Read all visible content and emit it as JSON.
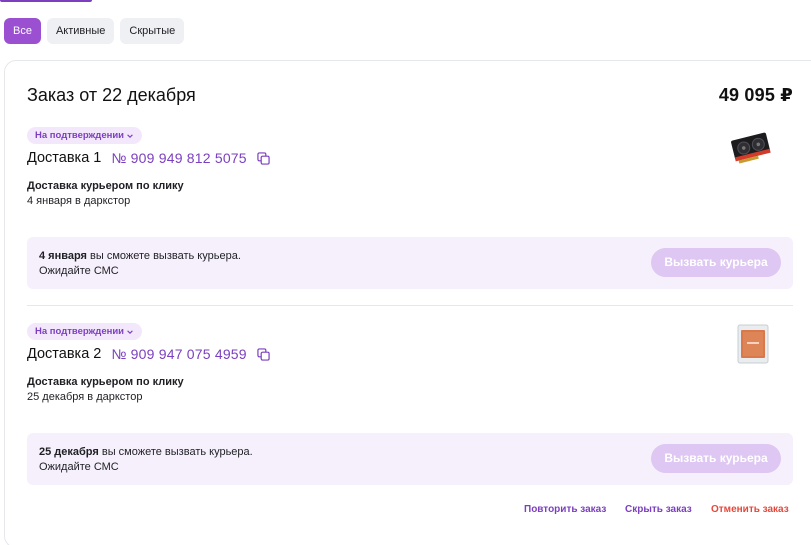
{
  "filters": {
    "all": "Все",
    "active": "Активные",
    "hidden": "Скрытые"
  },
  "order": {
    "title": "Заказ от 22 декабря",
    "total": "49 095 ₽",
    "deliveries": [
      {
        "status": "На подтверждении",
        "name": "Доставка 1",
        "number": "№ 909 949 812 5075",
        "method": "Доставка курьером по клику",
        "date": "4 января в даркстор",
        "courier_date": "4 января",
        "courier_text": " вы сможете вызвать курьера.",
        "courier_wait": "Ожидайте СМС",
        "courier_button": "Вызвать курьера",
        "thumb_icon": "graphics-card-icon"
      },
      {
        "status": "На подтверждении",
        "name": "Доставка 2",
        "number": "№ 909 947 075 4959",
        "method": "Доставка курьером по клику",
        "date": "25 декабря в даркстор",
        "courier_date": "25 декабря",
        "courier_text": " вы сможете вызвать курьера.",
        "courier_wait": "Ожидайте СМС",
        "courier_button": "Вызвать курьера",
        "thumb_icon": "thermal-pad-icon"
      }
    ],
    "actions": {
      "repeat": "Повторить заказ",
      "hide": "Скрыть заказ",
      "cancel": "Отменить заказ"
    }
  },
  "colors": {
    "accent": "#7b3fbf",
    "chip_active": "#9b4fd1",
    "cancel": "#e5483b",
    "courier_bg": "#f6f0fc"
  }
}
